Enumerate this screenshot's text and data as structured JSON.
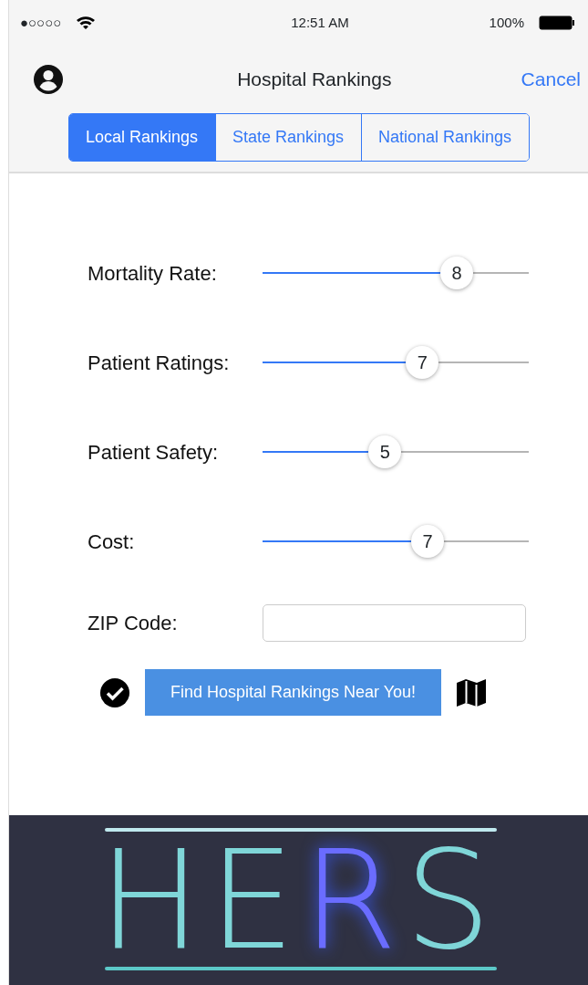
{
  "status_bar": {
    "signal_dots": "●○○○○",
    "time": "12:51 AM",
    "battery": "100%"
  },
  "nav": {
    "title": "Hospital Rankings",
    "cancel": "Cancel"
  },
  "tabs": [
    {
      "label": "Local Rankings",
      "selected": true
    },
    {
      "label": "State Rankings",
      "selected": false
    },
    {
      "label": "National Rankings",
      "selected": false
    }
  ],
  "sliders": [
    {
      "label": "Mortality Rate:",
      "level": 0.73,
      "reading": "8"
    },
    {
      "label": "Patient Ratings:",
      "level": 0.6,
      "reading": "7"
    },
    {
      "label": "Patient Safety:",
      "level": 0.46,
      "reading": "5"
    },
    {
      "label": "Cost:",
      "level": 0.62,
      "reading": "7"
    }
  ],
  "zip": {
    "label": "ZIP Code:"
  },
  "find_button": "Find Hospital Rankings Near You!",
  "logo": "HERS"
}
